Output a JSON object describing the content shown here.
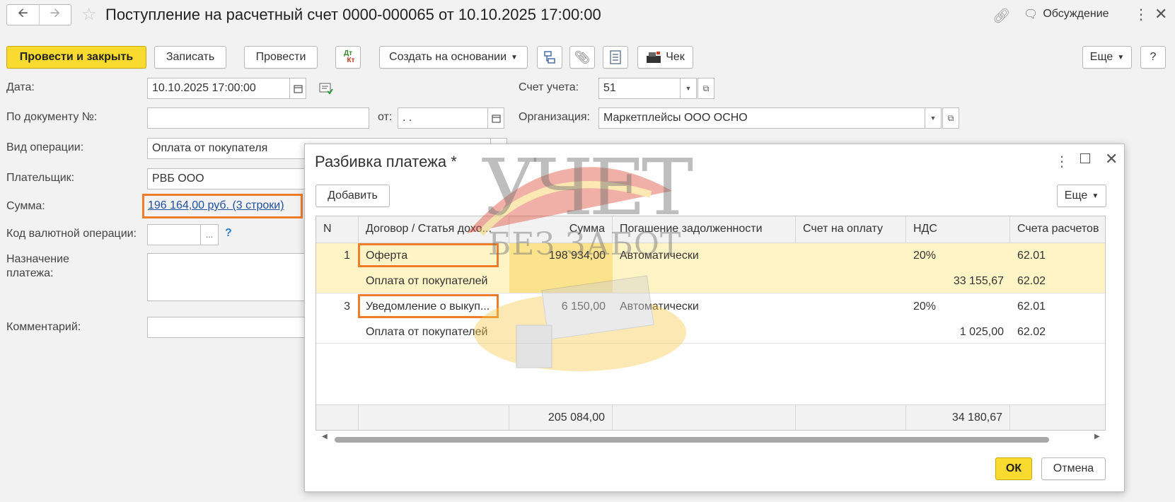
{
  "window": {
    "title": "Поступление на расчетный счет 0000-000065 от 10.10.2025 17:00:00",
    "discuss_label": "Обсуждение"
  },
  "toolbar": {
    "post_close": "Провести и закрыть",
    "save": "Записать",
    "post": "Провести",
    "dtkt_top": "Дт",
    "dtkt_bottom": "Кт",
    "create_based": "Создать на основании",
    "receipt": "Чек",
    "more": "Еще",
    "help": "?"
  },
  "form": {
    "date_label": "Дата:",
    "date_value": "10.10.2025 17:00:00",
    "account_label": "Счет учета:",
    "account_value": "51",
    "doc_no_label": "По документу №:",
    "doc_no_value": "",
    "from_label": "от:",
    "from_value": " .  .",
    "org_label": "Организация:",
    "org_value": "Маркетплейсы ООО ОСНО",
    "op_type_label": "Вид операции:",
    "op_type_value": "Оплата от покупателя",
    "payer_label": "Плательщик:",
    "payer_value": "РВБ ООО",
    "sum_label": "Сумма:",
    "sum_value": "196 164,00 руб. (3 строки)",
    "currency_label": "Код валютной операции:",
    "currency_value": "",
    "purpose_label_1": "Назначение",
    "purpose_label_2": "платежа:",
    "comment_label": "Комментарий:",
    "ellipsis": "...",
    "question": "?"
  },
  "dialog": {
    "title": "Разбивка платежа *",
    "add": "Добавить",
    "more": "Еще",
    "ok": "ОК",
    "cancel": "Отмена",
    "columns": [
      "N",
      "Договор / Статья дохо...",
      "Сумма",
      "Погашение задолженности",
      "Счет на оплату",
      "НДС",
      "Счета расчетов"
    ],
    "rows": [
      {
        "n": "1",
        "contract": "Оферта",
        "sum": "198 934,00",
        "repay": "Автоматически",
        "invoice": "",
        "vat": "20%",
        "acc1": "62.01",
        "article": "Оплата от покупателей",
        "vat_sum": "33 155,67",
        "acc2": "62.02"
      },
      {
        "n": "3",
        "contract": "Уведомление о выкуп...",
        "sum": "6 150,00",
        "repay": "Автоматически",
        "invoice": "",
        "vat": "20%",
        "acc1": "62.01",
        "article": "Оплата от покупателей",
        "vat_sum": "1 025,00",
        "acc2": "62.02"
      }
    ],
    "totals": {
      "sum": "205 084,00",
      "vat": "34 180,67"
    }
  },
  "watermark": {
    "line1": "УЧЕТ",
    "line2": "БЕЗ ЗАБОТ"
  },
  "colors": {
    "primary": "#f9da2e",
    "highlight": "#ee7d2b",
    "row_selected": "#fff4c6",
    "link": "#1f4f9e"
  }
}
